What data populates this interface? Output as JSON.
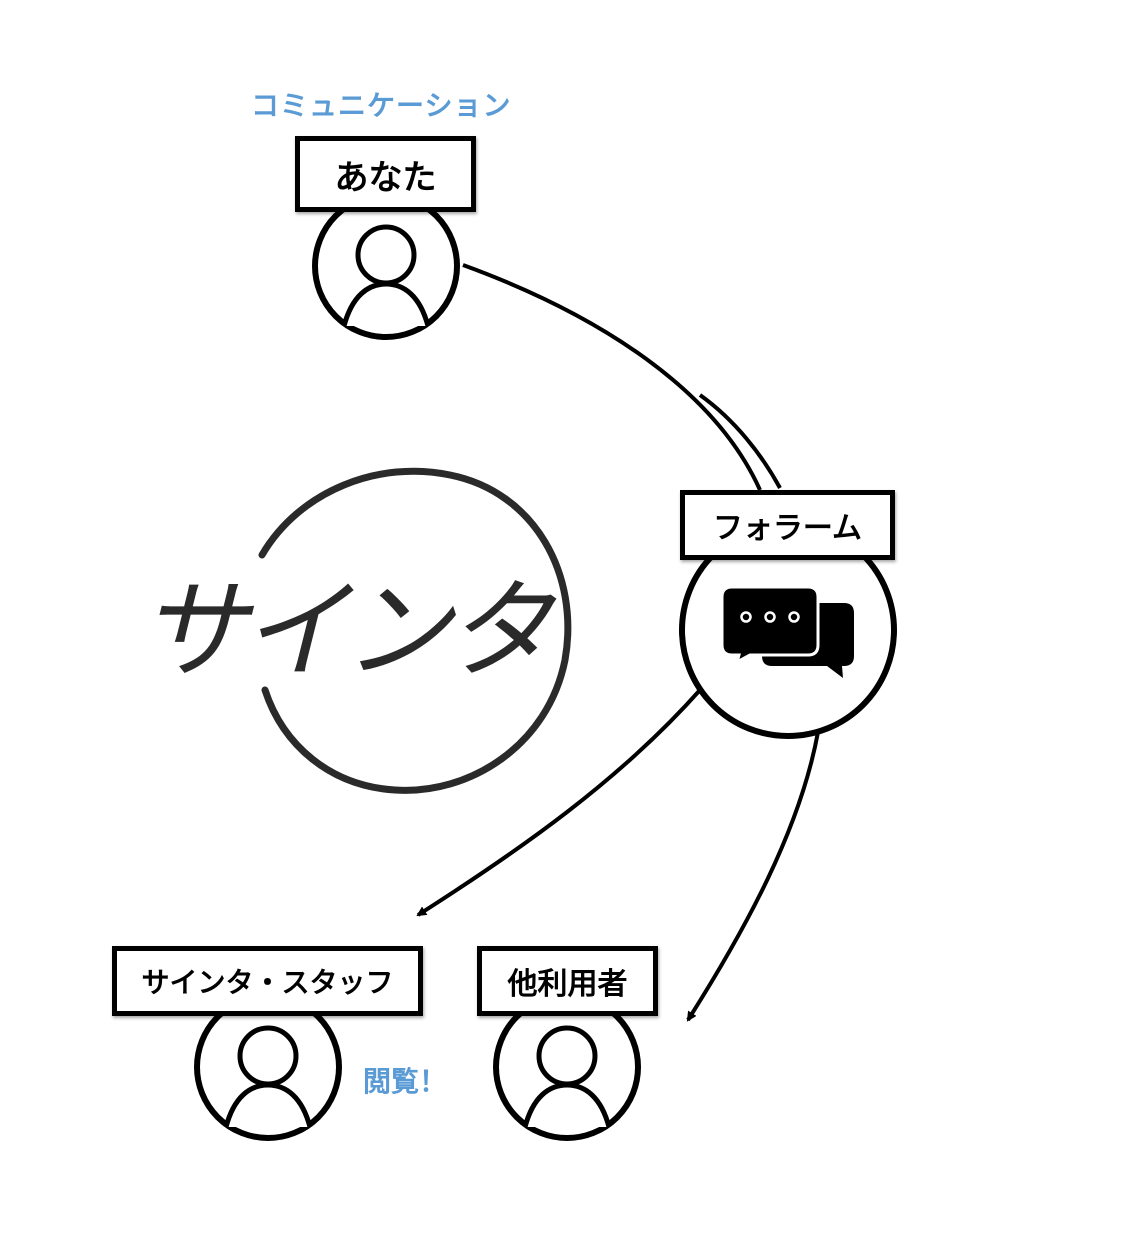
{
  "header": {
    "caption": "コミュニケーション"
  },
  "nodes": {
    "you": {
      "label": "あなた",
      "icon": "person-icon"
    },
    "forum": {
      "label": "フォラーム",
      "icon": "chat-bubbles-icon"
    },
    "staff": {
      "label": "サインタ・スタッフ",
      "icon": "person-icon"
    },
    "others": {
      "label": "他利用者",
      "icon": "person-icon"
    }
  },
  "annotations": {
    "view": "閲覧！"
  },
  "logo": {
    "text": "サインタ"
  },
  "colors": {
    "accent": "#5b9bd5",
    "line": "#000000",
    "logo": "#2a2a2a"
  }
}
